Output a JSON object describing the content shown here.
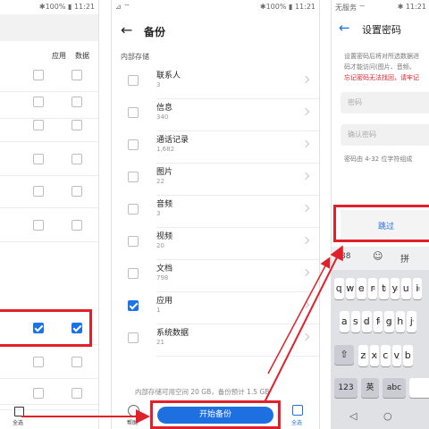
{
  "panel1": {
    "status": "✱100% ▮ 11:21",
    "headers": {
      "app": "应用",
      "data": "数据"
    },
    "select_all_label": "全选",
    "rows": [
      {
        "app_checked": false,
        "data_checked": false
      },
      {
        "app_checked": false,
        "data_checked": false
      },
      {
        "app_checked": false,
        "data_checked": false
      },
      {
        "app_checked": false,
        "data_checked": false
      },
      {
        "app_checked": false,
        "data_checked": false
      },
      {
        "app_checked": false,
        "data_checked": false
      },
      {
        "app_checked": true,
        "data_checked": true
      },
      {
        "app_checked": false,
        "data_checked": false
      },
      {
        "app_checked": false,
        "data_checked": false
      }
    ]
  },
  "panel2": {
    "status_left": "⊿ ⌔",
    "status_right": "✱100% ▮ 11:21",
    "title": "备份",
    "section": "内部存储",
    "items": [
      {
        "name": "联系人",
        "count": "3",
        "checked": false
      },
      {
        "name": "信息",
        "count": "340",
        "checked": false
      },
      {
        "name": "通话记录",
        "count": "1,682",
        "checked": false
      },
      {
        "name": "图片",
        "count": "22",
        "checked": false
      },
      {
        "name": "音频",
        "count": "3",
        "checked": false
      },
      {
        "name": "视频",
        "count": "20",
        "checked": false
      },
      {
        "name": "文档",
        "count": "798",
        "checked": false
      },
      {
        "name": "应用",
        "count": "1",
        "checked": true
      },
      {
        "name": "系统数据",
        "count": "21",
        "checked": false
      }
    ],
    "storage_note": "内部存储可用空间 20 GB，备份预计 1.5 GB",
    "left_bottom_label": "帮助",
    "start_button": "开始备份",
    "select_all_label": "全选"
  },
  "panel3": {
    "status_left": "无服务 ⌔",
    "status_right": "✱ 11:21",
    "title": "设置密码",
    "desc_lines": [
      "设置密码后将对所选数据进",
      "码才能访问(图片、音频、"
    ],
    "warning": "忘记密码无法找回，请牢记",
    "password_placeholder": "密码",
    "confirm_placeholder": "确认密码",
    "hint": "密码由 4-32 位字符组成",
    "skip_label": "跳过",
    "kb_toolbar": [
      "88",
      "☺",
      "拼"
    ],
    "keys_row1": [
      {
        "k": "q",
        "n": "1"
      },
      {
        "k": "w",
        "n": "2"
      },
      {
        "k": "e",
        "n": "3"
      },
      {
        "k": "r",
        "n": "4"
      },
      {
        "k": "t",
        "n": "5"
      },
      {
        "k": "y",
        "n": "6"
      },
      {
        "k": "u",
        "n": "7"
      },
      {
        "k": "i",
        "n": "8"
      }
    ],
    "keys_row2": [
      {
        "k": "a",
        "n": "~"
      },
      {
        "k": "s",
        "n": "!"
      },
      {
        "k": "d",
        "n": "@"
      },
      {
        "k": "f",
        "n": "#"
      },
      {
        "k": "g",
        "n": "%"
      },
      {
        "k": "h",
        "n": "\""
      },
      {
        "k": "j",
        "n": "\""
      }
    ],
    "keys_row3": [
      {
        "k": "z",
        "n": "("
      },
      {
        "k": "x",
        "n": ")"
      },
      {
        "k": "c",
        "n": "-"
      },
      {
        "k": "v",
        "n": "_"
      },
      {
        "k": "b",
        "n": ":"
      }
    ],
    "shift": "⇧",
    "key_123": "123",
    "key_lang": "英",
    "key_abc": "abc",
    "nav": [
      "◁",
      "○"
    ]
  }
}
